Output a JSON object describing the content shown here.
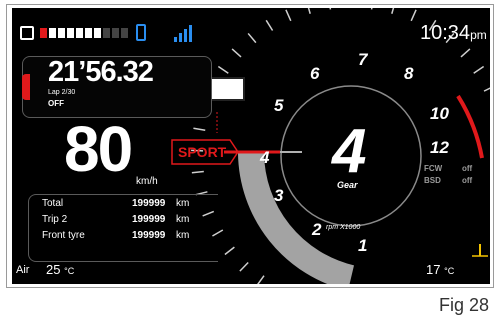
{
  "topbar": {
    "clock": "10:34",
    "clock_suffix": "pm",
    "fuel_filled_segments": 7,
    "fuel_total_segments": 10,
    "signal_bars": 4
  },
  "lap": {
    "time": "21’56.32",
    "lap_label": "Lap 2/30",
    "status": "OFF"
  },
  "speed": {
    "value": "80",
    "unit": "km/h"
  },
  "mode": {
    "label": "SPORT",
    "color": "#e0191b"
  },
  "gear": {
    "value": "4",
    "label": "Gear",
    "rpm_unit": "rpm X1000"
  },
  "tach": {
    "labels": [
      "1",
      "2",
      "3",
      "4",
      "5",
      "6",
      "7",
      "8",
      "10",
      "12"
    ],
    "redline_color": "#e0191b"
  },
  "assist": {
    "fcw_label": "FCW",
    "fcw_value": "off",
    "bsd_label": "BSD",
    "bsd_value": "off"
  },
  "trip": {
    "rows": [
      {
        "label": "Total",
        "value": "199999",
        "unit": "km"
      },
      {
        "label": "Trip 2",
        "value": "199999",
        "unit": "km"
      },
      {
        "label": "Front tyre",
        "value": "199999",
        "unit": "km"
      }
    ]
  },
  "air": {
    "label": "Air",
    "value": "25",
    "unit": "°C"
  },
  "coolant": {
    "value": "17",
    "unit": "°C"
  },
  "caption": "Fig 28",
  "colors": {
    "accent_red": "#e0191b",
    "tick_grey": "#cfcfcf",
    "icon_blue": "#2a8ef0"
  }
}
